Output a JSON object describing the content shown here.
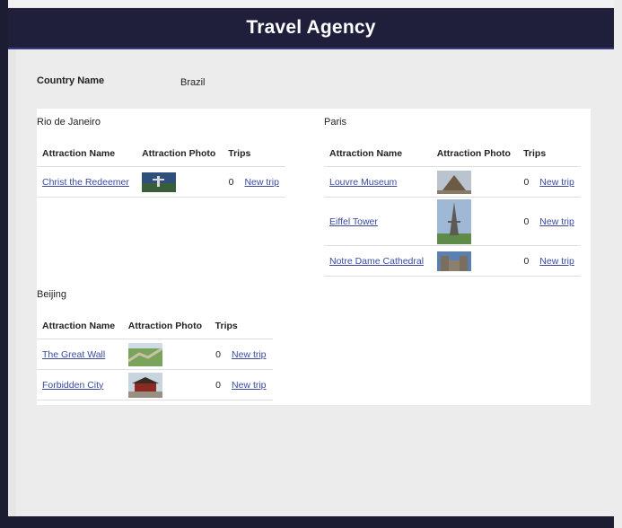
{
  "app": {
    "title": "Travel Agency"
  },
  "country": {
    "label": "Country Name",
    "value": "Brazil"
  },
  "columns": {
    "name": "Attraction Name",
    "photo": "Attraction Photo",
    "trips": "Trips"
  },
  "cities": [
    {
      "name": "Rio de Janeiro",
      "attractions": [
        {
          "name": "Christ the Redeemer",
          "photo": "christ-the-redeemer-photo",
          "trips": "0",
          "action": "New trip"
        }
      ]
    },
    {
      "name": "Paris",
      "attractions": [
        {
          "name": "Louvre Museum",
          "photo": "louvre-museum-photo",
          "trips": "0",
          "action": "New trip"
        },
        {
          "name": "Eiffel Tower",
          "photo": "eiffel-tower-photo",
          "trips": "0",
          "action": "New trip"
        },
        {
          "name": "Notre Dame Cathedral",
          "photo": "notre-dame-photo",
          "trips": "0",
          "action": "New trip"
        }
      ]
    },
    {
      "name": "Beijing",
      "attractions": [
        {
          "name": "The Great Wall",
          "photo": "great-wall-photo",
          "trips": "0",
          "action": "New trip"
        },
        {
          "name": "Forbidden City",
          "photo": "forbidden-city-photo",
          "trips": "0",
          "action": "New trip"
        }
      ]
    }
  ],
  "colors": {
    "header": "#1f1f3c",
    "link": "#3a4aa0",
    "panel": "#ffffff"
  }
}
